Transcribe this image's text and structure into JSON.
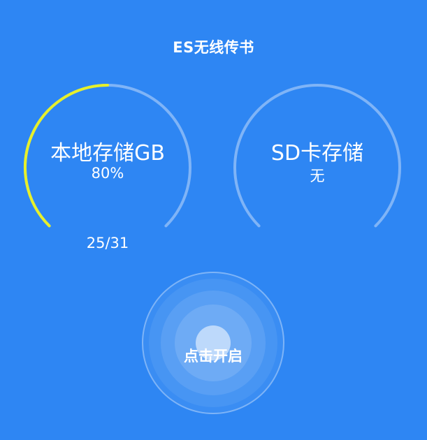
{
  "header": {
    "title": "ES无线传书"
  },
  "storage": {
    "local": {
      "label": "本地存储GB",
      "value_text": "80%",
      "count_text": "25/31",
      "fill_fraction": 0.8
    },
    "sd": {
      "label": "SD卡存储",
      "value_text": "无"
    }
  },
  "action": {
    "start_label": "点击开启"
  },
  "colors": {
    "background": "#2E86F3",
    "track": "#7FB4F7",
    "progress": "#E6F02A",
    "text": "#FFFFFF"
  },
  "icons": {
    "gauge": "arc-gauge"
  }
}
